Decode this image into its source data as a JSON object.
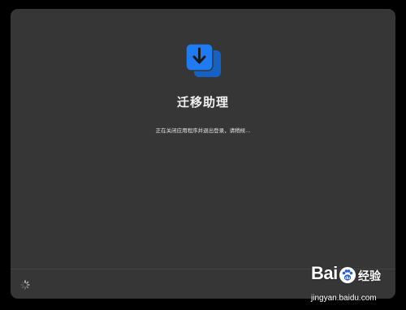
{
  "window": {
    "background": "#363636"
  },
  "app": {
    "icon": "migration-download-icon",
    "icon_color": "#1f7bf2",
    "title": "迁移助理",
    "status": "正在关闭应用程序并退出登录，请稍候..."
  },
  "footer": {
    "spinner_icon": "loading-spinner-icon"
  },
  "watermark": {
    "brand": "Bai",
    "brand_suffix": "经验",
    "paw_icon": "baidu-paw-icon",
    "url": "jingyan.baidu.com"
  }
}
